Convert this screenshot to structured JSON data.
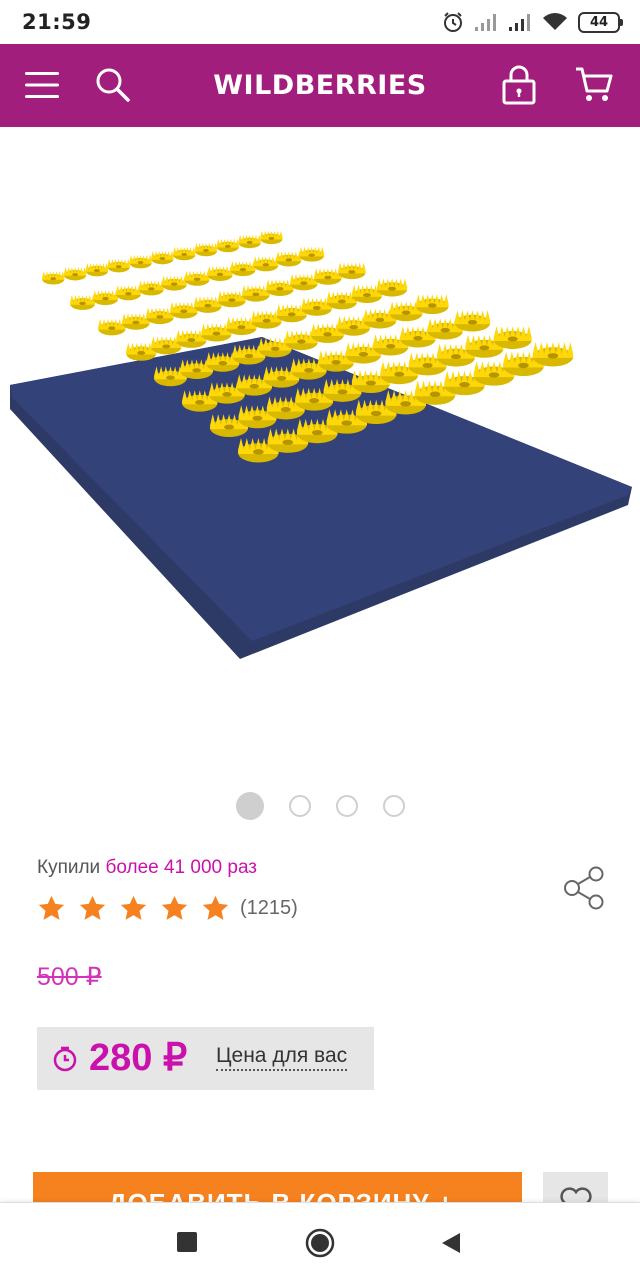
{
  "status_bar": {
    "time": "21:59",
    "battery": "44",
    "icons": [
      "alarm-icon",
      "signal-icon",
      "signal-icon",
      "wifi-icon",
      "battery-icon"
    ]
  },
  "header": {
    "brand": "WILDBERRIES",
    "icons": [
      "menu-icon",
      "search-icon",
      "lock-icon",
      "cart-icon"
    ],
    "color": "#a21e7d"
  },
  "gallery": {
    "total_images": 4,
    "active_index": 0
  },
  "product": {
    "bought_prefix": "Купили",
    "bought_count": "более 41 000 раз",
    "rating": 5,
    "reviews": "(1215)",
    "old_price": "500 ₽",
    "price": "280 ₽",
    "price_note": "Цена для вас"
  },
  "actions": {
    "add_to_cart": "ДОБАВИТЬ В КОРЗИНУ +",
    "accent": "#f5821f",
    "highlight": "#cb11ab"
  },
  "nav": {
    "icons": [
      "recents-icon",
      "home-icon",
      "back-icon"
    ]
  }
}
